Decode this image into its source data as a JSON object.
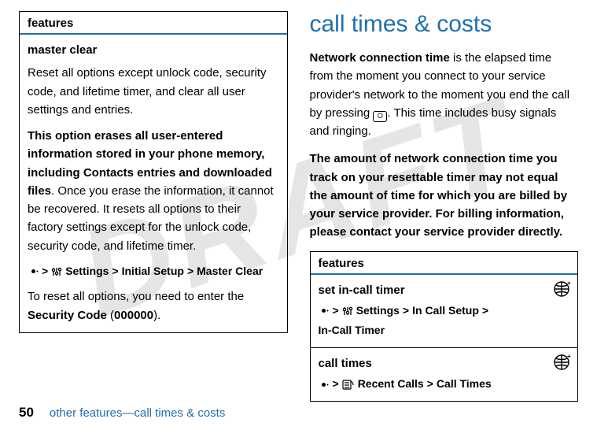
{
  "watermark": "DRAFT",
  "left_table": {
    "header": "features",
    "subhead": "master clear",
    "para1": "Reset all options except unlock code, security code, and lifetime timer, and clear all user settings and entries.",
    "para2a": "This option erases all user-entered information stored in your phone memory, including Contacts entries and downloaded files",
    "para2b": ". Once you erase the information, it cannot be recovered. It resets all options to their factory settings except for the unlock code, security code, and lifetime timer.",
    "path": {
      "gt": ">",
      "settings": "Settings",
      "initial": "Initial Setup",
      "master": "Master Clear"
    },
    "para3a": "To reset all options, you need to enter the ",
    "para3b": "Security Code",
    "para3c": " (",
    "para3d": "000000",
    "para3e": ")."
  },
  "right": {
    "title": "call times & costs",
    "p1a": "Network connection time",
    "p1b": " is the elapsed time from the moment you connect to your service provider's network to the moment you end the call by pressing ",
    "p1c": ". This time includes busy signals and ringing.",
    "p2": "The amount of network connection time you track on your resettable timer may not equal the amount of time for which you are billed by your service provider. For billing information, please contact your service provider directly.",
    "table": {
      "header": "features",
      "row1_title": "set in-call timer",
      "row1_path": {
        "gt": ">",
        "settings": "Settings",
        "incall": "In Call Setup",
        "timer": "In-Call Timer"
      },
      "row2_title": "call times",
      "row2_path": {
        "gt": ">",
        "recent": "Recent Calls",
        "times": "Call Times"
      }
    }
  },
  "footer": {
    "page": "50",
    "text": "other features—call times & costs"
  },
  "end_key_glyph": "O"
}
